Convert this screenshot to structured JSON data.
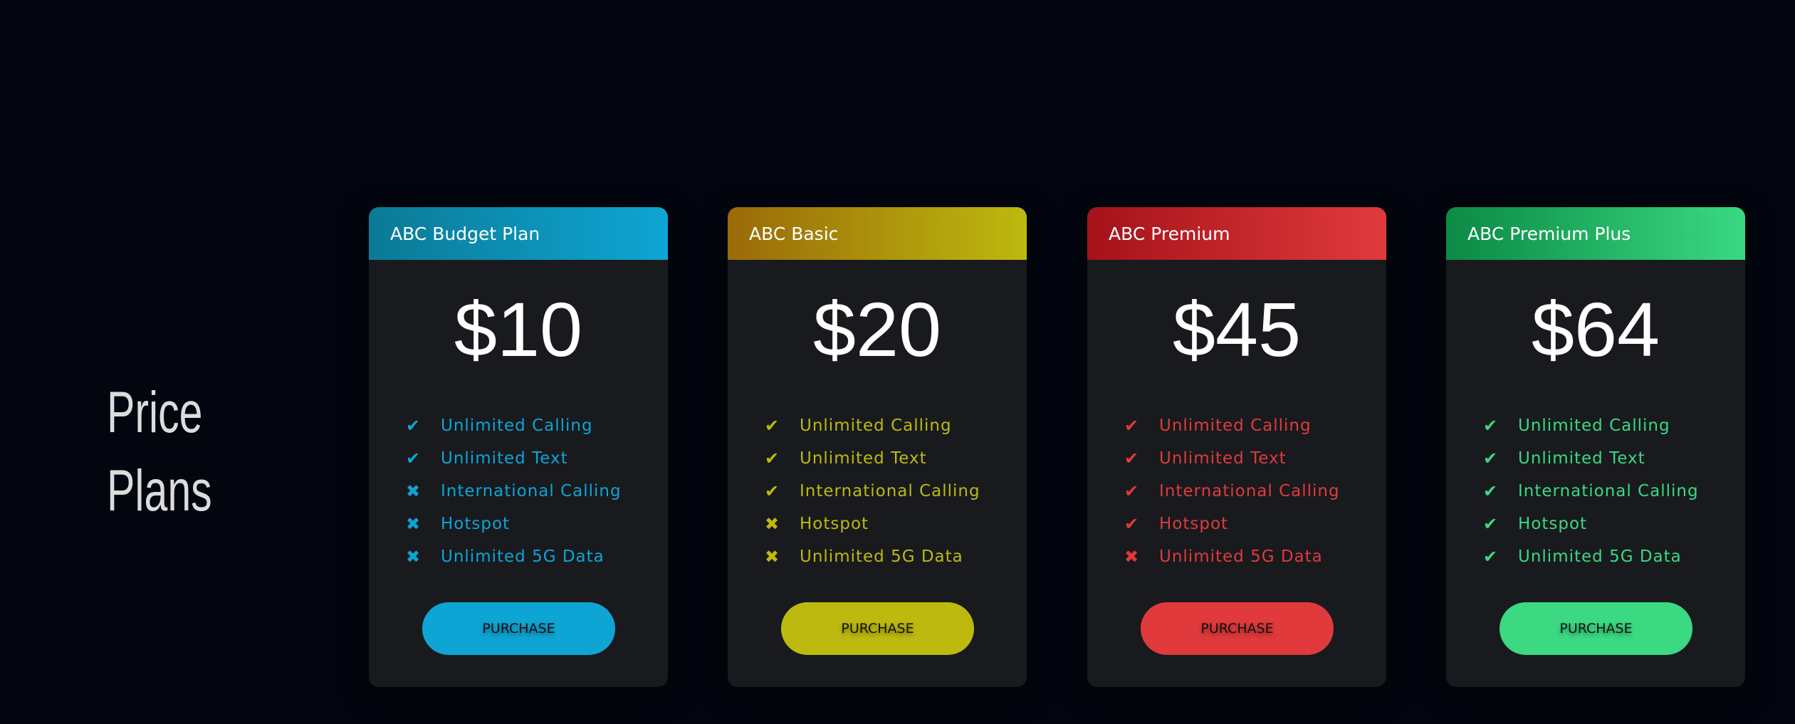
{
  "heading": {
    "line1": "Price",
    "line2": "Plans"
  },
  "features": [
    "Unlimited Calling",
    "Unlimited Text",
    "International Calling",
    "Hotspot",
    "Unlimited 5G Data"
  ],
  "plans": [
    {
      "name": "ABC Budget Plan",
      "price": "$10",
      "included": [
        true,
        true,
        false,
        false,
        false
      ],
      "color": "#0ea5d4",
      "grad_from": "#0b7a96",
      "button": "PURCHASE"
    },
    {
      "name": "ABC Basic",
      "price": "$20",
      "included": [
        true,
        true,
        true,
        false,
        false
      ],
      "color": "#bdb90f",
      "grad_from": "#9a6a08",
      "button": "PURCHASE"
    },
    {
      "name": "ABC Premium",
      "price": "$45",
      "included": [
        true,
        true,
        true,
        true,
        false
      ],
      "color": "#e03a3c",
      "grad_from": "#a5121a",
      "button": "PURCHASE"
    },
    {
      "name": "ABC Premium Plus",
      "price": "$64",
      "included": [
        true,
        true,
        true,
        true,
        true
      ],
      "color": "#3ad982",
      "grad_from": "#0b8a45",
      "button": "PURCHASE"
    }
  ],
  "icons": {
    "included": "check-icon",
    "excluded": "x-icon"
  }
}
